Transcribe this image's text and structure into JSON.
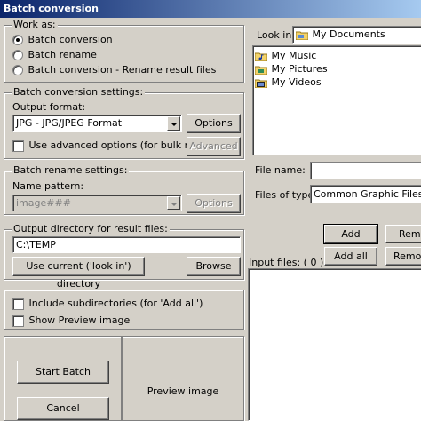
{
  "window": {
    "title": "Batch conversion"
  },
  "work_as": {
    "legend": "Work as:",
    "options": [
      {
        "label": "Batch conversion",
        "selected": true
      },
      {
        "label": "Batch rename",
        "selected": false
      },
      {
        "label": "Batch conversion - Rename result files",
        "selected": false
      }
    ]
  },
  "conversion_settings": {
    "legend": "Batch conversion settings:",
    "output_format_label": "Output format:",
    "output_format_value": "JPG - JPG/JPEG Format",
    "options_button": "Options",
    "advanced_checkbox_label": "Use advanced options (for bulk resize...)",
    "advanced_button": "Advanced"
  },
  "rename_settings": {
    "legend": "Batch rename settings:",
    "pattern_label": "Name pattern:",
    "pattern_value": "image###",
    "options_button": "Options"
  },
  "output_dir": {
    "legend": "Output directory for result files:",
    "value": "C:\\TEMP",
    "use_current_button": "Use current ('look in') directory",
    "browse_button": "Browse"
  },
  "extra_options": {
    "include_subdirs_label": "Include subdirectories (for 'Add all')",
    "show_preview_label": "Show Preview image"
  },
  "actions": {
    "start_button": "Start Batch",
    "cancel_button": "Cancel",
    "preview_label": "Preview image"
  },
  "browser": {
    "look_in_label": "Look in:",
    "look_in_value": "My Documents",
    "items": [
      {
        "label": "My Music"
      },
      {
        "label": "My Pictures"
      },
      {
        "label": "My Videos"
      }
    ],
    "file_name_label": "File name:",
    "file_name_value": "",
    "files_of_type_label": "Files of type:",
    "files_of_type_value": "Common Graphic Files",
    "add_button": "Add",
    "remove_button": "Remo",
    "add_all_button": "Add all",
    "remove_all_button": "Remov",
    "input_files_label": "Input files: ( 0 )"
  }
}
